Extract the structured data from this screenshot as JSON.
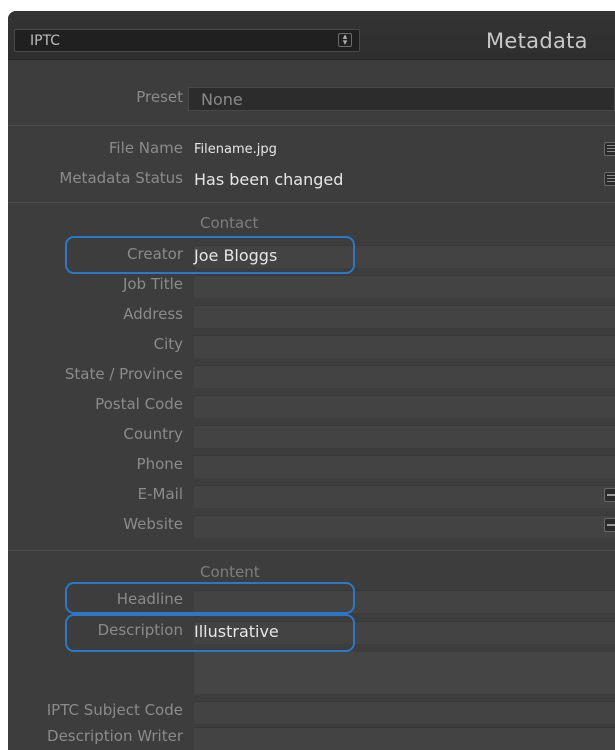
{
  "header": {
    "selector": "IPTC",
    "title": "Metadata"
  },
  "preset": {
    "label": "Preset",
    "value": "None"
  },
  "file": {
    "name_label": "File Name",
    "name_value": "Filename.jpg",
    "status_label": "Metadata Status",
    "status_value": "Has been changed"
  },
  "contact": {
    "title": "Contact",
    "creator_label": "Creator",
    "creator_value": "Joe Bloggs",
    "job_title": "Job Title",
    "address": "Address",
    "city": "City",
    "state": "State / Province",
    "postal": "Postal Code",
    "country": "Country",
    "phone": "Phone",
    "email": "E-Mail",
    "website": "Website"
  },
  "content": {
    "title": "Content",
    "headline_label": "Headline",
    "description_label": "Description",
    "description_value": "Illustrative",
    "subject_code": "IPTC Subject Code",
    "description_writer": "Description Writer"
  },
  "icons": {
    "stepper": "updown-stepper-icon",
    "list": "list-icon",
    "dash": "dash-icon"
  },
  "colors": {
    "highlight": "#2c77c8",
    "panel": "#3d3d3d"
  }
}
